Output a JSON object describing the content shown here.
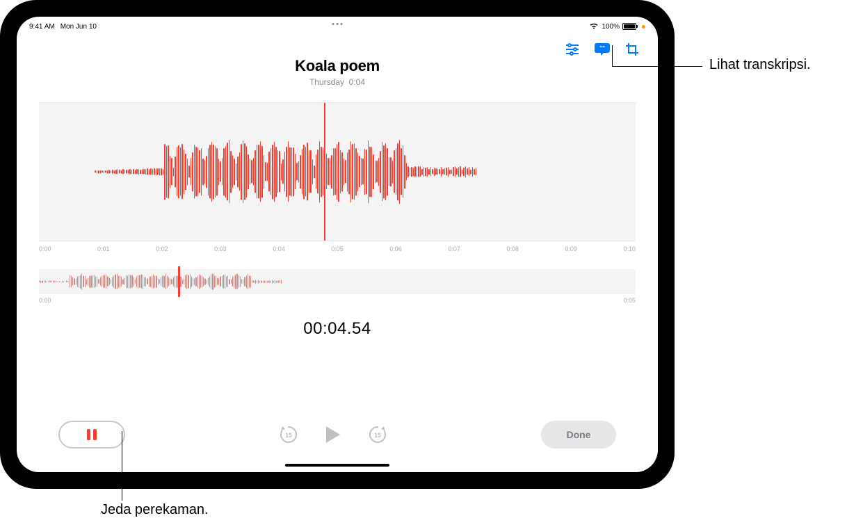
{
  "status": {
    "time": "9:41 AM",
    "date": "Mon Jun 10",
    "wifi": "wifi",
    "batteryPct": "100%"
  },
  "toolbar": {
    "optionsIcon": "options-icon",
    "transcriptIcon": "transcript-icon",
    "trimIcon": "trim-icon"
  },
  "recording": {
    "title": "Koala poem",
    "day": "Thursday",
    "totalDuration": "0:04"
  },
  "ruler": {
    "labels": [
      "0:00",
      "0:01",
      "0:02",
      "0:03",
      "0:04",
      "0:05",
      "0:06",
      "0:07",
      "0:08",
      "0:09",
      "0:10"
    ]
  },
  "overviewRuler": {
    "start": "0:00",
    "end": "0:05"
  },
  "timer": "00:04.54",
  "controls": {
    "pause": "Pause",
    "skipBack": "15",
    "play": "Play",
    "skipFwd": "15",
    "done": "Done"
  },
  "callouts": {
    "transcript": "Lihat transkripsi.",
    "pause": "Jeda perekaman."
  }
}
